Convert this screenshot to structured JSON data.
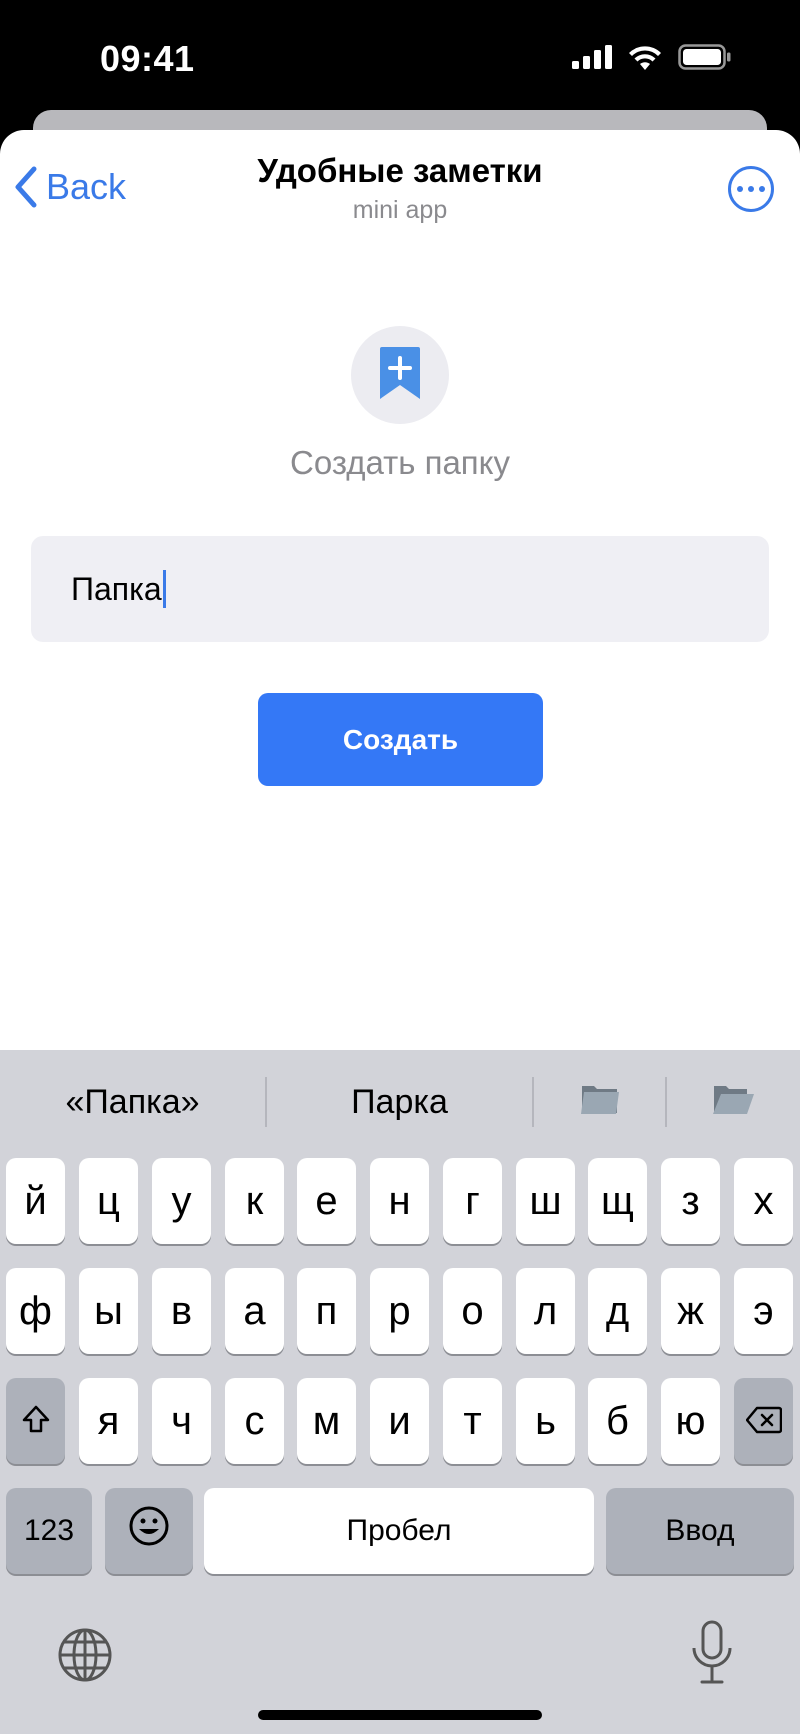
{
  "status_bar": {
    "time": "09:41"
  },
  "header": {
    "back_label": "Back",
    "title": "Удобные заметки",
    "subtitle": "mini app"
  },
  "main": {
    "create_folder_label": "Создать папку",
    "input_value": "Папка",
    "create_button_label": "Создать"
  },
  "keyboard": {
    "suggestions": [
      "«Папка»",
      "Парка"
    ],
    "row1": [
      "й",
      "ц",
      "у",
      "к",
      "е",
      "н",
      "г",
      "ш",
      "щ",
      "з",
      "х"
    ],
    "row2": [
      "ф",
      "ы",
      "в",
      "а",
      "п",
      "р",
      "о",
      "л",
      "д",
      "ж",
      "э"
    ],
    "row3": [
      "я",
      "ч",
      "с",
      "м",
      "и",
      "т",
      "ь",
      "б",
      "ю"
    ],
    "numbers_label": "123",
    "space_label": "Пробел",
    "return_label": "Ввод"
  },
  "colors": {
    "accent": "#3478f6",
    "link": "#3a7ae8"
  }
}
